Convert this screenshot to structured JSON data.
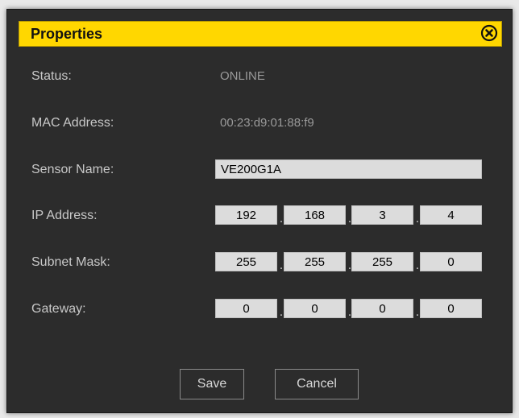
{
  "dialog": {
    "title": "Properties",
    "close_icon": "close-circle-icon",
    "accent_color": "#ffd700"
  },
  "status": {
    "label": "Status:",
    "value": "ONLINE"
  },
  "mac": {
    "label": "MAC Address:",
    "value": "00:23:d9:01:88:f9"
  },
  "sensor_name": {
    "label": "Sensor Name:",
    "value": "VE200G1A"
  },
  "ip_address": {
    "label": "IP Address:",
    "octets": [
      "192",
      "168",
      "3",
      "4"
    ]
  },
  "subnet_mask": {
    "label": "Subnet Mask:",
    "octets": [
      "255",
      "255",
      "255",
      "0"
    ]
  },
  "gateway": {
    "label": "Gateway:",
    "octets": [
      "0",
      "0",
      "0",
      "0"
    ]
  },
  "separator": ".",
  "buttons": {
    "save_label": "Save",
    "cancel_label": "Cancel"
  }
}
